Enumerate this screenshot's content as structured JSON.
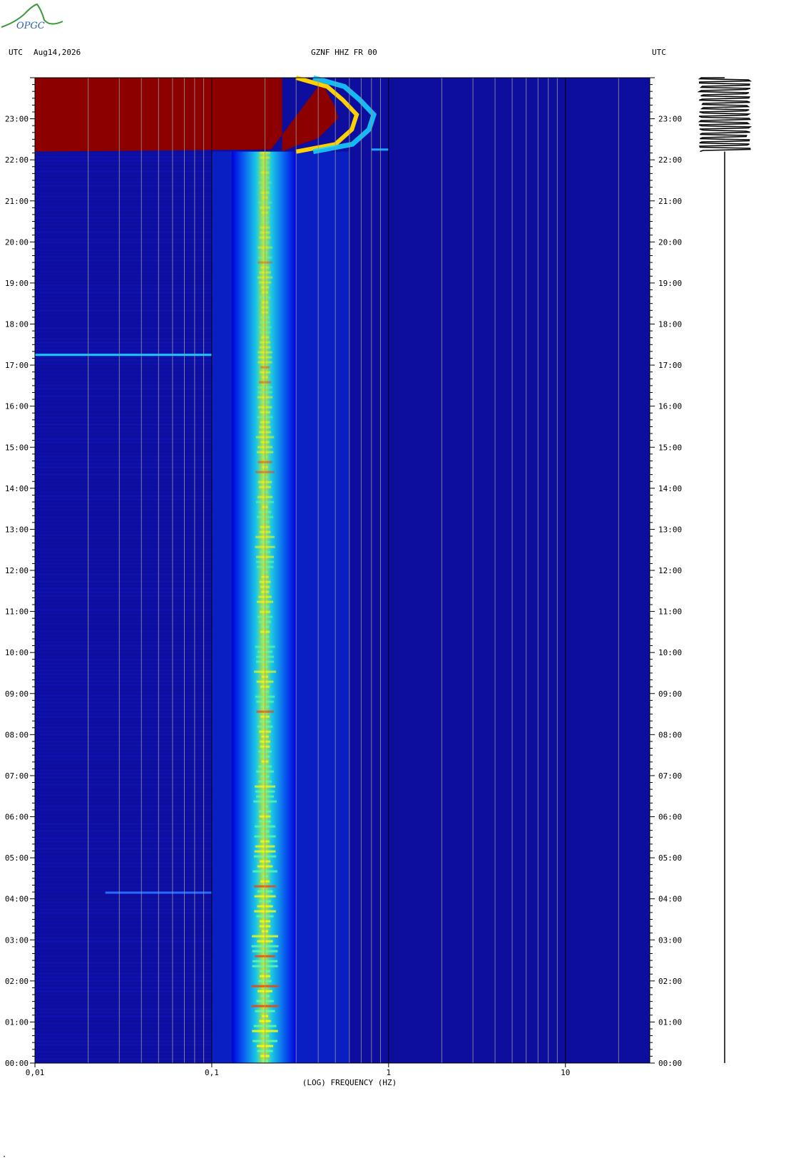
{
  "logo": {
    "text": "OPGC"
  },
  "header": {
    "left_tz": "UTC",
    "date": "Aug14,2026",
    "station": "GZNF HHZ FR 00",
    "right_tz": "UTC"
  },
  "footer": {
    "corner_mark": "\""
  },
  "chart_data": {
    "type": "heatmap",
    "title": "GZNF HHZ FR 00",
    "xlabel": "(LOG) FREQUENCY (HZ)",
    "ylabel": "UTC",
    "x_scale": "log",
    "xlim": [
      0.01,
      30
    ],
    "x_ticks": [
      "0.01",
      "0.1",
      "1",
      "10"
    ],
    "y_ticks": [
      "00:00",
      "01:00",
      "02:00",
      "03:00",
      "04:00",
      "05:00",
      "06:00",
      "07:00",
      "08:00",
      "09:00",
      "10:00",
      "11:00",
      "12:00",
      "13:00",
      "14:00",
      "15:00",
      "16:00",
      "17:00",
      "18:00",
      "19:00",
      "20:00",
      "21:00",
      "22:00",
      "23:00"
    ],
    "ylim_hours": [
      0,
      24
    ],
    "colormap": [
      "#00008c",
      "#0000ff",
      "#00c8ff",
      "#ffff00",
      "#ff0000",
      "#8c0000"
    ],
    "background_color": "#0d0d9e",
    "features": [
      {
        "name": "microseism band",
        "freq_range_hz": [
          0.13,
          0.3
        ],
        "peak_hz": 0.2,
        "time_range_h": [
          0,
          22.2
        ]
      },
      {
        "name": "saturated event",
        "time_range_h": [
          22.2,
          24
        ],
        "freq_upper_hz": 0.8
      },
      {
        "name": "narrow line",
        "time_h": 17.25,
        "freq_range_hz": [
          0.01,
          0.1
        ]
      },
      {
        "name": "narrow line",
        "time_h": 4.15,
        "freq_range_hz": [
          0.025,
          0.1
        ]
      }
    ],
    "seismogram": {
      "event_start_h": 22.2,
      "trace_color": "#000000"
    }
  }
}
